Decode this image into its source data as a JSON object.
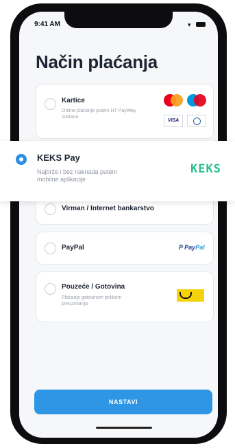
{
  "status_bar": {
    "time": "9:41 AM"
  },
  "page": {
    "title": "Način plaćanja"
  },
  "methods": {
    "cards": {
      "label": "Kartice",
      "description": "Online plaćanje putem HT PayWay sustava",
      "visa": "VISA"
    },
    "keks": {
      "label": "KEKS Pay",
      "description": "Najbrže i bez naknada putem mobilne aplikacije",
      "logo": "KEKS"
    },
    "transfer": {
      "label": "Virman / Internet bankarstvo"
    },
    "paypal": {
      "label": "PayPal",
      "logo_a": "Pay",
      "logo_b": "Pal"
    },
    "cod": {
      "label": "Pouzeće / Gotovina",
      "description": "Plaćanje gotovinom prilikom preuzimanja"
    }
  },
  "footer": {
    "continue_label": "NASTAVI"
  },
  "colors": {
    "accent": "#2f96e6",
    "keks": "#2bbf8c"
  }
}
